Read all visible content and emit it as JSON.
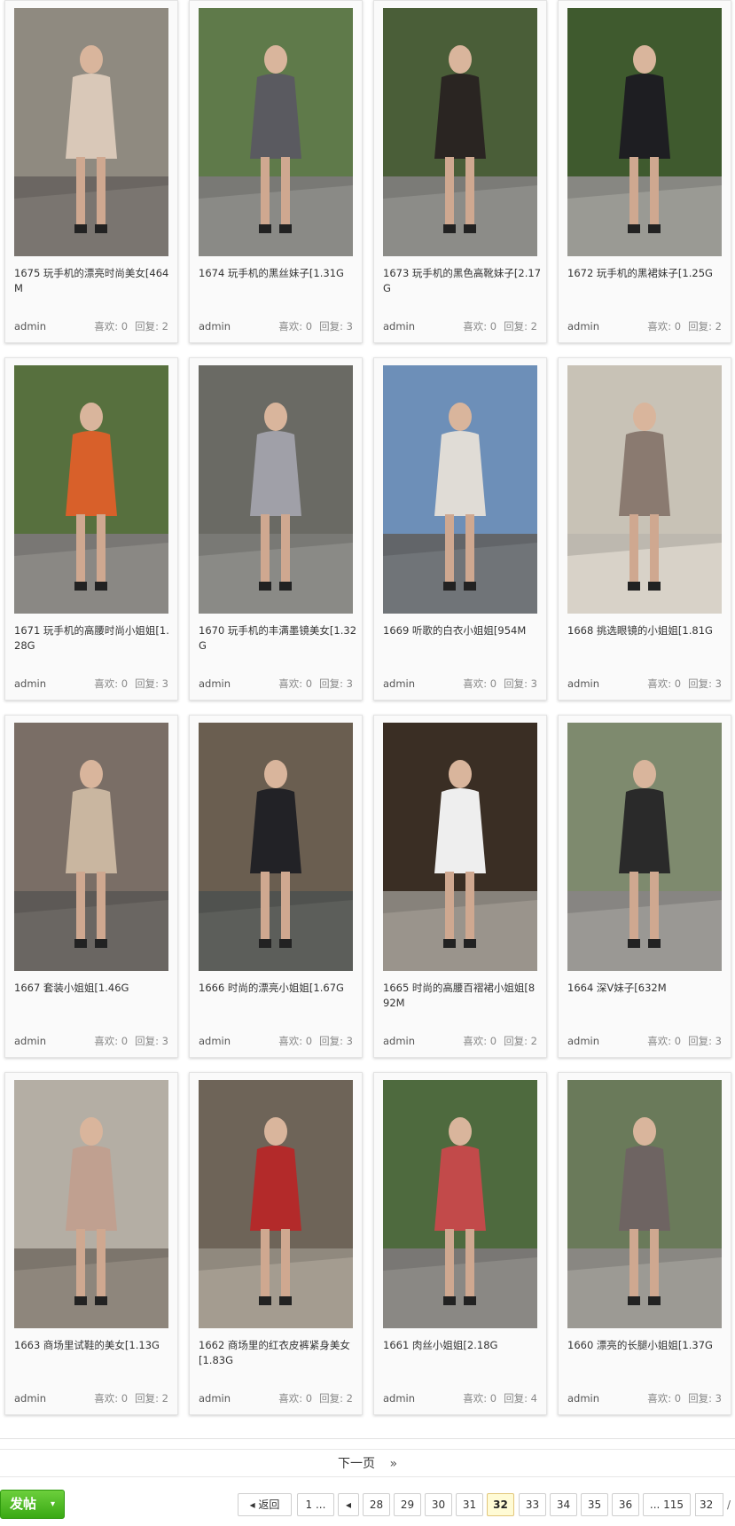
{
  "posts": [
    {
      "title": "1675 玩手机的漂亮时尚美女[464M",
      "author": "admin",
      "likes": "喜欢: 0",
      "replies": "回复: 2"
    },
    {
      "title": "1674 玩手机的黑丝妹子[1.31G",
      "author": "admin",
      "likes": "喜欢: 0",
      "replies": "回复: 3"
    },
    {
      "title": "1673 玩手机的黑色高靴妹子[2.17G",
      "author": "admin",
      "likes": "喜欢: 0",
      "replies": "回复: 2"
    },
    {
      "title": "1672 玩手机的黑裙妹子[1.25G",
      "author": "admin",
      "likes": "喜欢: 0",
      "replies": "回复: 2"
    },
    {
      "title": "1671 玩手机的高腰时尚小姐姐[1.28G",
      "author": "admin",
      "likes": "喜欢: 0",
      "replies": "回复: 3"
    },
    {
      "title": "1670 玩手机的丰满墨镜美女[1.32G",
      "author": "admin",
      "likes": "喜欢: 0",
      "replies": "回复: 3"
    },
    {
      "title": "1669 听歌的白衣小姐姐[954M",
      "author": "admin",
      "likes": "喜欢: 0",
      "replies": "回复: 3"
    },
    {
      "title": "1668 挑选眼镜的小姐姐[1.81G",
      "author": "admin",
      "likes": "喜欢: 0",
      "replies": "回复: 3"
    },
    {
      "title": "1667 套装小姐姐[1.46G",
      "author": "admin",
      "likes": "喜欢: 0",
      "replies": "回复: 3"
    },
    {
      "title": "1666 时尚的漂亮小姐姐[1.67G",
      "author": "admin",
      "likes": "喜欢: 0",
      "replies": "回复: 3"
    },
    {
      "title": "1665 时尚的高腰百褶裙小姐姐[892M",
      "author": "admin",
      "likes": "喜欢: 0",
      "replies": "回复: 2"
    },
    {
      "title": "1664 深V妹子[632M",
      "author": "admin",
      "likes": "喜欢: 0",
      "replies": "回复: 3"
    },
    {
      "title": "1663 商场里试鞋的美女[1.13G",
      "author": "admin",
      "likes": "喜欢: 0",
      "replies": "回复: 2"
    },
    {
      "title": "1662 商场里的红衣皮裤紧身美女[1.83G",
      "author": "admin",
      "likes": "喜欢: 0",
      "replies": "回复: 2"
    },
    {
      "title": "1661 肉丝小姐姐[2.18G",
      "author": "admin",
      "likes": "喜欢: 0",
      "replies": "回复: 4"
    },
    {
      "title": "1660 漂亮的长腿小姐姐[1.37G",
      "author": "admin",
      "likes": "喜欢: 0",
      "replies": "回复: 3"
    }
  ],
  "thumb_colors": [
    {
      "bg": "#8f8a80",
      "fg": "#d9c8b8",
      "ground": "#7a7570"
    },
    {
      "bg": "#5f7a4a",
      "fg": "#5a5a60",
      "ground": "#8a8a86"
    },
    {
      "bg": "#4a5e38",
      "fg": "#2a2522",
      "ground": "#8c8c88"
    },
    {
      "bg": "#3f5a2e",
      "fg": "#1e1e22",
      "ground": "#9a9a94"
    },
    {
      "bg": "#57703e",
      "fg": "#d8602a",
      "ground": "#8a8884"
    },
    {
      "bg": "#6a6a64",
      "fg": "#a0a0a8",
      "ground": "#8a8a86"
    },
    {
      "bg": "#6d8fb8",
      "fg": "#e0dcd6",
      "ground": "#707478"
    },
    {
      "bg": "#c8c2b6",
      "fg": "#8a7a70",
      "ground": "#d8d2c8"
    },
    {
      "bg": "#7a6e66",
      "fg": "#c9b6a0",
      "ground": "#6a6662"
    },
    {
      "bg": "#6a5e50",
      "fg": "#222226",
      "ground": "#5c5e5a"
    },
    {
      "bg": "#3a2e24",
      "fg": "#eeeeee",
      "ground": "#9a948c"
    },
    {
      "bg": "#7e8a6e",
      "fg": "#2a2a2a",
      "ground": "#9a9894"
    },
    {
      "bg": "#b4aea4",
      "fg": "#c0a090",
      "ground": "#8e867c"
    },
    {
      "bg": "#6e6458",
      "fg": "#b32a2a",
      "ground": "#a49c90"
    },
    {
      "bg": "#4e6a3e",
      "fg": "#c24a4a",
      "ground": "#8a8884"
    },
    {
      "bg": "#6a7a5a",
      "fg": "#6e6462",
      "ground": "#9c9a94"
    }
  ],
  "next_page": {
    "label": "下一页",
    "arrow": "»"
  },
  "post_button": {
    "label": "发帖",
    "caret": "▾"
  },
  "pager": {
    "back": "返回",
    "first": "1 ...",
    "prev": "◂",
    "pages": [
      "28",
      "29",
      "30",
      "31",
      "32",
      "33",
      "34",
      "35",
      "36"
    ],
    "current": "32",
    "last": "... 115",
    "input_value": "32",
    "slash": "/"
  }
}
